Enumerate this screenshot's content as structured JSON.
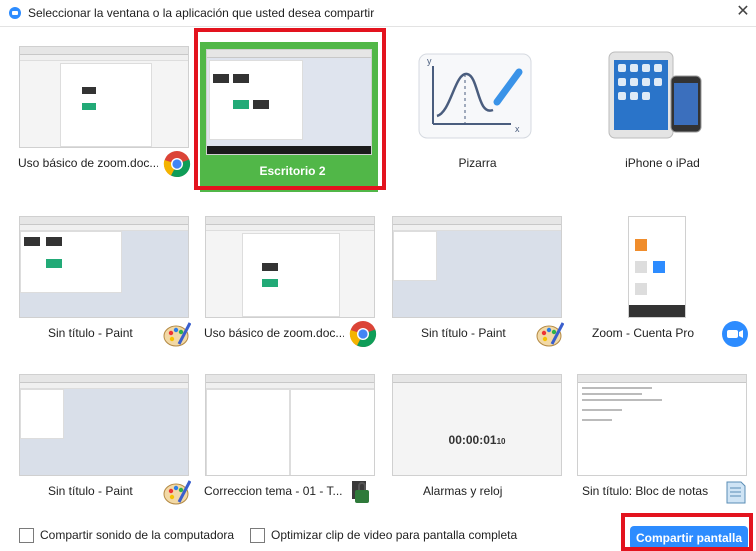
{
  "window": {
    "title": "Seleccionar la ventana o la aplicación que usted desea compartir",
    "close": "✕"
  },
  "tiles": [
    {
      "label": "Uso básico de zoom.doc...",
      "icon": "chrome-icon"
    },
    {
      "label": "Escritorio 2",
      "selected": true
    },
    {
      "label": "Pizarra",
      "icon": "whiteboard-icon"
    },
    {
      "label": "iPhone o iPad",
      "icon": "ipad-iphone-icon"
    },
    {
      "label": "Sin título - Paint",
      "icon": "paint-icon"
    },
    {
      "label": "Uso básico de zoom.doc...",
      "icon": "chrome-icon"
    },
    {
      "label": "Sin título - Paint",
      "icon": "paint-icon"
    },
    {
      "label": "Zoom - Cuenta Pro",
      "icon": "zoom-icon"
    },
    {
      "label": "Sin título - Paint",
      "icon": "paint-icon"
    },
    {
      "label": "Correccion tema - 01 - T...",
      "icon": "security-file-icon"
    },
    {
      "label": "Alarmas y reloj",
      "icon": "clock-app-thumbnail",
      "clock_text": "00:00:01",
      "clock_ms": "10"
    },
    {
      "label": "Sin título: Bloc de notas",
      "icon": "notepad-icon"
    }
  ],
  "footer": {
    "share_sound_label": "Compartir sonido de la computadora",
    "optimize_video_label": "Optimizar clip de video para pantalla completa",
    "share_button": "Compartir pantalla"
  },
  "colors": {
    "selected_tile": "#51b748",
    "highlight_frame": "#e3131e",
    "primary_button": "#2d8cff"
  }
}
